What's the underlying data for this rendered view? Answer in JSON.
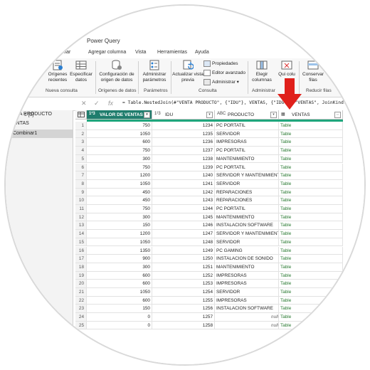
{
  "app": {
    "title": "Power Query"
  },
  "tabs": [
    "rmar",
    "Agregar columna",
    "Vista",
    "Herramientas",
    "Ayuda"
  ],
  "ribbon": {
    "buttons": [
      {
        "label": "Orígenes recientes",
        "icon": "recent-sources-icon"
      },
      {
        "label": "Especificar datos",
        "icon": "table-icon"
      },
      {
        "label": "Configuración de origen de datos",
        "icon": "data-source-settings-icon"
      },
      {
        "label": "Administrar parámetros",
        "icon": "parameters-icon"
      },
      {
        "label": "Actualizar vista previa",
        "icon": "refresh-icon"
      },
      {
        "label": "Elegir columnas",
        "icon": "choose-columns-icon"
      },
      {
        "label": "Qui colu",
        "icon": "remove-columns-icon"
      },
      {
        "label": "Conservar filas",
        "icon": "keep-rows-icon"
      }
    ],
    "small": [
      "Propiedades",
      "Editor avanzado",
      "Administrar"
    ],
    "groups": [
      "Nueva consulta",
      "Orígenes de datos",
      "Parámetros",
      "Consulta",
      "Administrar",
      "Reducir filas"
    ]
  },
  "formula": "= Table.NestedJoin(#\"VENTA PRODUCTO\", {\"IDU\"}, VENTAS, {\"IDU\"}, \"VENTAS\", JoinKind.F",
  "queries": {
    "header": "s [3]",
    "items": [
      {
        "name": "NTA PRODUCTO",
        "selected": false
      },
      {
        "name": "ENTAS",
        "selected": false
      },
      {
        "name": "Combinar1",
        "selected": true
      }
    ]
  },
  "grid": {
    "columns": [
      {
        "type": "1²3",
        "name": "VALOR DE VENTAS"
      },
      {
        "type": "1²3",
        "name": "IDU"
      },
      {
        "type": "ABC",
        "name": "PRODUCTO"
      },
      {
        "type": "▦",
        "name": "VENTAS"
      }
    ],
    "rows": [
      [
        "1",
        "750",
        "1234",
        "PC PORTATIL",
        "Table"
      ],
      [
        "2",
        "1050",
        "1235",
        "SERVIDOR",
        "Table"
      ],
      [
        "3",
        "600",
        "1236",
        "IMPRESORAS",
        "Table"
      ],
      [
        "4",
        "750",
        "1237",
        "PC PORTATIL",
        "Table"
      ],
      [
        "5",
        "300",
        "1238",
        "MANTENIMIENTO",
        "Table"
      ],
      [
        "6",
        "750",
        "1239",
        "PC PORTATIL",
        "Table"
      ],
      [
        "7",
        "1200",
        "1240",
        "SERVIDOR Y MANTENIMIENTO",
        "Table"
      ],
      [
        "8",
        "1050",
        "1241",
        "SERVIDOR",
        "Table"
      ],
      [
        "9",
        "450",
        "1242",
        "REPARACIONES",
        "Table"
      ],
      [
        "10",
        "450",
        "1243",
        "REPARACIONES",
        "Table"
      ],
      [
        "11",
        "750",
        "1244",
        "PC PORTATIL",
        "Table"
      ],
      [
        "12",
        "300",
        "1245",
        "MANTENIMIENTO",
        "Table"
      ],
      [
        "13",
        "150",
        "1246",
        "INSTALACION SOFTWARE",
        "Table"
      ],
      [
        "14",
        "1200",
        "1247",
        "SERVIDOR Y MANTENIMIENTO",
        "Table"
      ],
      [
        "15",
        "1050",
        "1248",
        "SERVIDOR",
        "Table"
      ],
      [
        "16",
        "1350",
        "1249",
        "PC GAMING",
        "Table"
      ],
      [
        "17",
        "900",
        "1250",
        "INSTALACION DE SONIDO",
        "Table"
      ],
      [
        "18",
        "300",
        "1251",
        "MANTENIMIENTO",
        "Table"
      ],
      [
        "19",
        "600",
        "1252",
        "IMPRESORAS",
        "Table"
      ],
      [
        "20",
        "600",
        "1253",
        "IMPRESORAS",
        "Table"
      ],
      [
        "21",
        "1050",
        "1254",
        "SERVIDOR",
        "Table"
      ],
      [
        "22",
        "600",
        "1255",
        "IMPRESORAS",
        "Table"
      ],
      [
        "23",
        "150",
        "1256",
        "INSTALACION SOFTWARE",
        "Table"
      ],
      [
        "24",
        "0",
        "1257",
        "null",
        "Table"
      ],
      [
        "25",
        "0",
        "1258",
        "null",
        "Table"
      ]
    ]
  },
  "colors": {
    "accent": "#1f7d6d",
    "table_link": "#2a7a32",
    "arrow": "#e0201b"
  }
}
